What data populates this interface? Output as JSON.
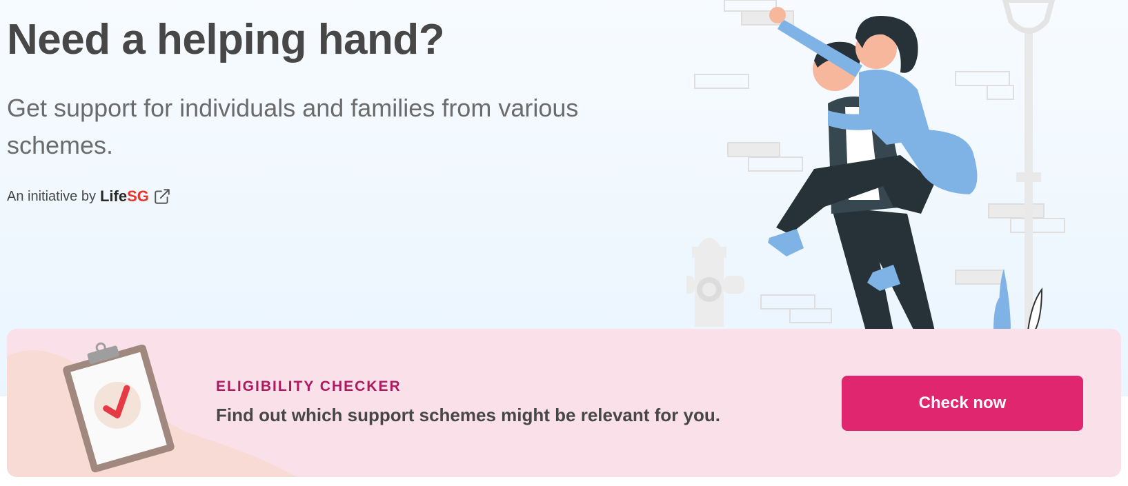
{
  "hero": {
    "title": "Need a helping hand?",
    "subtitle": "Get support for individuals and families from various schemes.",
    "initiative_prefix": "An initiative by",
    "brand_part1": "Life",
    "brand_part2": "SG",
    "external_link_icon": "external-link-icon"
  },
  "eligibility": {
    "label": "ELIGIBILITY CHECKER",
    "description": "Find out which support schemes might be relevant for you.",
    "button_label": "Check now",
    "icon": "clipboard-check-icon"
  },
  "colors": {
    "accent": "#e0266f",
    "label": "#b0175f",
    "card_bg": "#fae1e9",
    "brand_red": "#e8332b",
    "text": "#474747"
  }
}
